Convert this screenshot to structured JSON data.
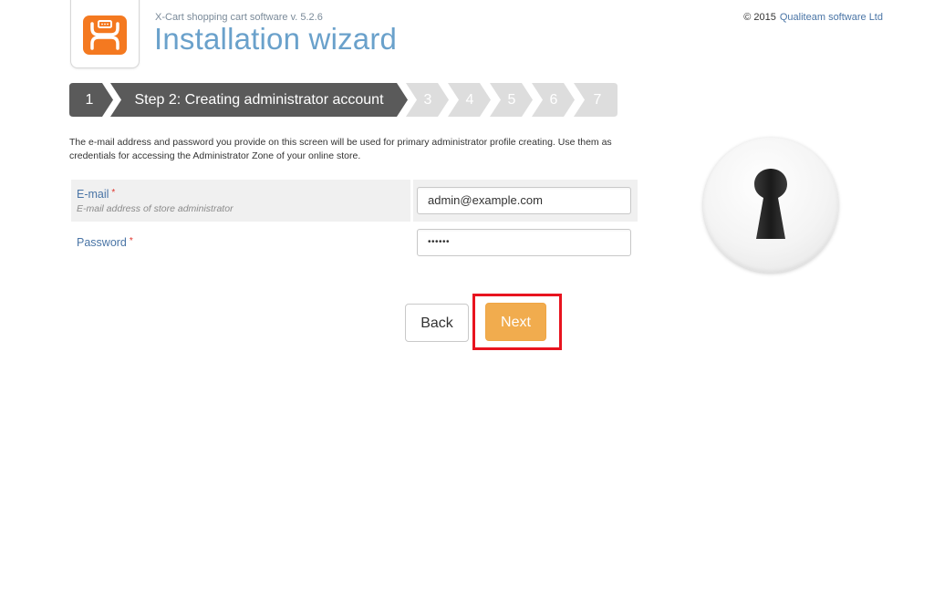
{
  "header": {
    "subtitle": "X-Cart shopping cart software v. 5.2.6",
    "title": "Installation wizard",
    "copyright_text": "© 2015",
    "copyright_link": "Qualiteam software Ltd",
    "logo_icon": "x-cart-logo"
  },
  "steps": {
    "items": [
      {
        "label": "1",
        "state": "done"
      },
      {
        "label": "Step 2: Creating administrator account",
        "state": "current"
      },
      {
        "label": "3",
        "state": "pending"
      },
      {
        "label": "4",
        "state": "pending"
      },
      {
        "label": "5",
        "state": "pending"
      },
      {
        "label": "6",
        "state": "pending"
      },
      {
        "label": "7",
        "state": "pending"
      }
    ]
  },
  "intro": {
    "text": "The e-mail address and password you provide on this screen will be used for primary administrator profile creating. Use them as credentials for accessing the Administrator Zone of your online store."
  },
  "form": {
    "email": {
      "label": "E-mail",
      "required_mark": "*",
      "hint": "E-mail address of store administrator",
      "value": "admin@example.com"
    },
    "password": {
      "label": "Password",
      "required_mark": "*",
      "value": "••••••"
    }
  },
  "side_image": {
    "icon": "keyhole-icon"
  },
  "buttons": {
    "back_label": "Back",
    "next_label": "Next"
  },
  "colors": {
    "accent_orange": "#f1ac4e",
    "step_active": "#5a5a5a",
    "step_pending": "#dddddd",
    "title_blue": "#6aa1cb",
    "label_blue": "#4a75a6",
    "required_red": "#e0322b",
    "highlight_red": "#e8141f"
  }
}
